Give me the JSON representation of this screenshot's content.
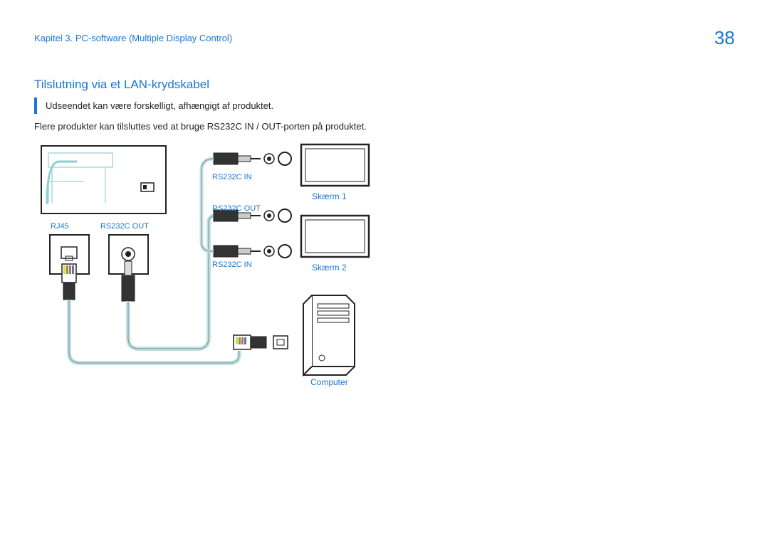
{
  "header": {
    "chapter": "Kapitel 3. PC-software (Multiple Display Control)",
    "page": "38"
  },
  "section_title": "Tilslutning via et LAN-krydskabel",
  "note": "Udseendet kan være forskelligt, afhængigt af produktet.",
  "body": "Flere produkter kan tilsluttes ved at bruge RS232C IN / OUT-porten på produktet.",
  "labels": {
    "rj45": "RJ45",
    "rs232c_out_left": "RS232C OUT",
    "rs232c_in_1": "RS232C IN",
    "rs232c_out_mid": "RS232C OUT",
    "rs232c_in_2": "RS232C IN",
    "screen1": "Skærm 1",
    "screen2": "Skærm 2",
    "computer": "Computer"
  }
}
